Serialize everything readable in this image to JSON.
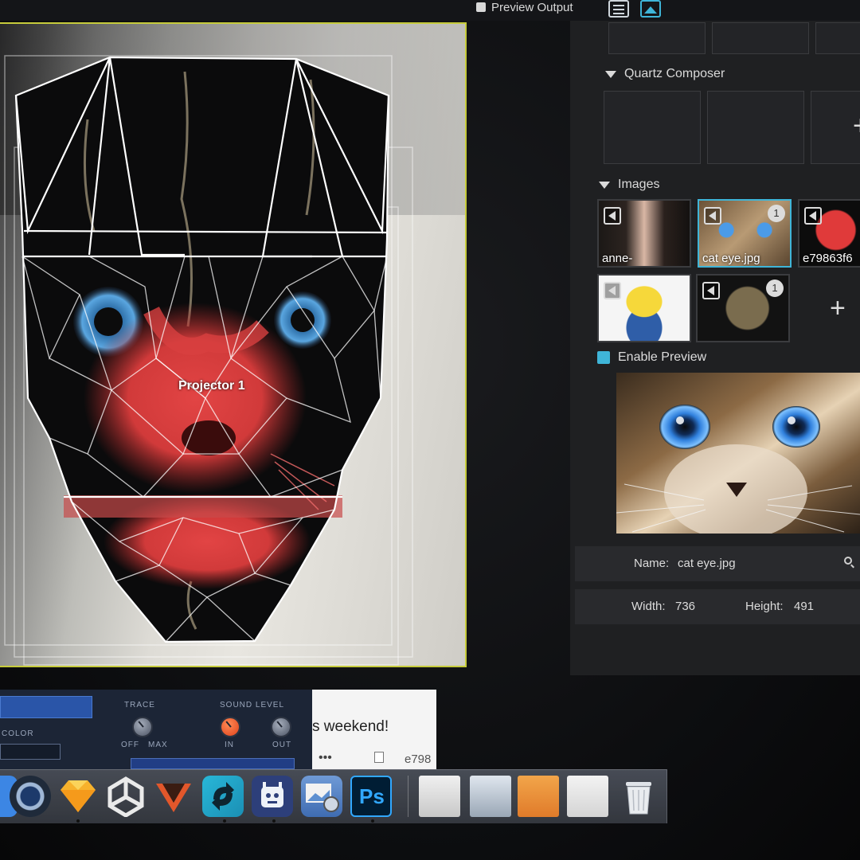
{
  "window": {
    "preview_output_label": "Preview Output"
  },
  "canvas": {
    "projector_label": "Projector 1"
  },
  "sections": {
    "quartz_composer": "Quartz Composer",
    "images": "Images"
  },
  "images": [
    {
      "label": "anne-",
      "selected": false,
      "badge": ""
    },
    {
      "label": "cat eye.jpg",
      "selected": true,
      "badge": "1"
    },
    {
      "label": "e79863f6",
      "selected": false,
      "badge": ""
    },
    {
      "label": "",
      "selected": false,
      "badge": ""
    },
    {
      "label": "",
      "selected": false,
      "badge": "1"
    }
  ],
  "preview": {
    "enable_label": "Enable Preview",
    "name_label": "Name:",
    "name_value": "cat eye.jpg",
    "width_label": "Width:",
    "width_value": "736",
    "height_label": "Height:",
    "height_value": "491"
  },
  "audio": {
    "color_label": "COLOR",
    "trace_label": "TRACE",
    "off_label": "OFF",
    "max_label": "MAX",
    "sound_level_label": "SOUND LEVEL",
    "in_label": "IN",
    "out_label": "OUT"
  },
  "chat": {
    "message": "s weekend!",
    "more": "•••",
    "filename": "e798"
  },
  "dock": {
    "photoshop_label": "Ps"
  },
  "colors": {
    "accent": "#3fb5d8",
    "canvas_border": "#c6cb3b",
    "panel_bg": "#1f2022"
  }
}
